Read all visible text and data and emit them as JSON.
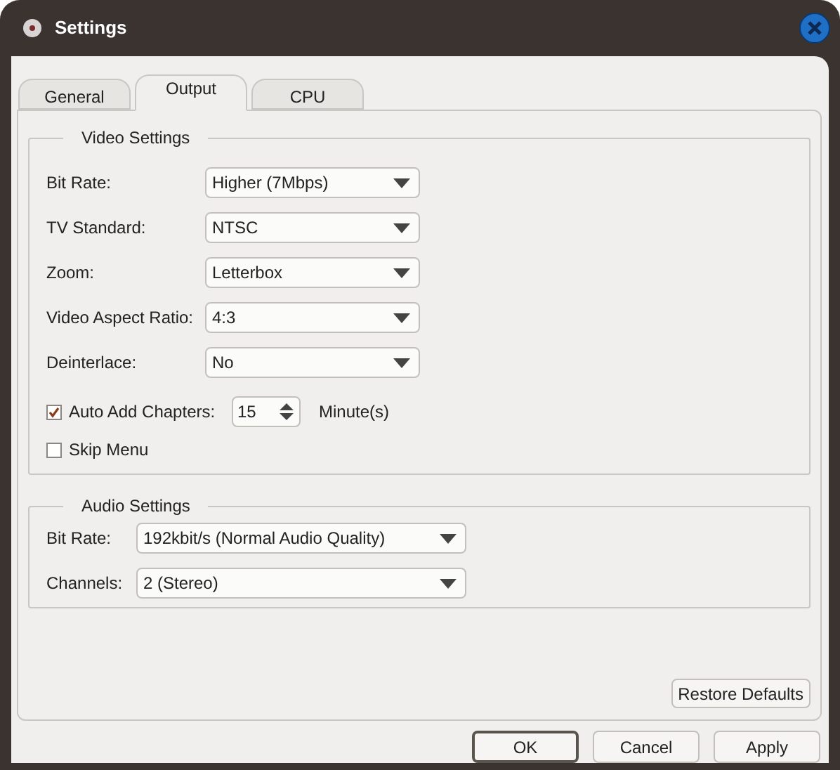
{
  "window": {
    "title": "Settings"
  },
  "tabs": [
    {
      "label": "General",
      "selected": false
    },
    {
      "label": "Output",
      "selected": true
    },
    {
      "label": "CPU",
      "selected": false
    }
  ],
  "video_settings": {
    "title": "Video Settings",
    "fields": [
      {
        "label": "Bit Rate:",
        "value": "Higher (7Mbps)"
      },
      {
        "label": "TV Standard:",
        "value": "NTSC"
      },
      {
        "label": "Zoom:",
        "value": "Letterbox"
      },
      {
        "label": "Video Aspect Ratio:",
        "value": "4:3"
      },
      {
        "label": "Deinterlace:",
        "value": "No"
      }
    ],
    "auto_add_chapters": {
      "label": "Auto Add Chapters:",
      "checked": true,
      "value": "15",
      "unit": "Minute(s)"
    },
    "skip_menu": {
      "label": "Skip Menu",
      "checked": false
    }
  },
  "audio_settings": {
    "title": "Audio Settings",
    "fields": [
      {
        "label": "Bit Rate:",
        "value": "192kbit/s (Normal Audio Quality)"
      },
      {
        "label": "Channels:",
        "value": "2 (Stereo)"
      }
    ]
  },
  "restore_button": {
    "label": "Restore Defaults"
  },
  "buttons": [
    {
      "label": "OK",
      "default": true
    },
    {
      "label": "Cancel",
      "default": false
    },
    {
      "label": "Apply",
      "default": false
    }
  ]
}
